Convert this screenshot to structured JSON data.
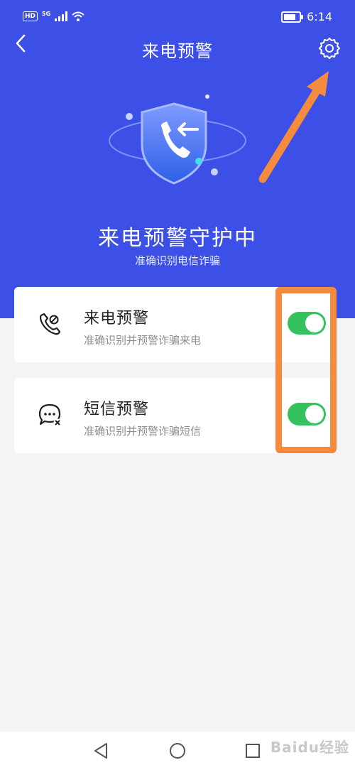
{
  "status_bar": {
    "network_badge": "HD",
    "network_type": "5G",
    "time": "6:14"
  },
  "header": {
    "title": "来电预警",
    "back_icon": "chevron-left-icon",
    "settings_icon": "gear-icon"
  },
  "hero": {
    "status_title": "来电预警守护中",
    "status_subtitle": "准确识别电信诈骗",
    "illustration_icon": "shield-phone-icon"
  },
  "features": [
    {
      "title": "来电预警",
      "description": "准确识别并预警诈骗来电",
      "icon": "phone-warning-icon",
      "enabled": true
    },
    {
      "title": "短信预警",
      "description": "准确识别并预警诈骗短信",
      "icon": "message-warning-icon",
      "enabled": true
    }
  ],
  "nav_bar": {
    "back_icon": "triangle-back-icon",
    "home_icon": "circle-home-icon",
    "recents_icon": "square-recents-icon"
  },
  "colors": {
    "hero_bg": "#3c4fe6",
    "toggle_on": "#33c25e",
    "annotation": "#f58b3c",
    "page_bg": "#f4f4f6"
  },
  "watermark": "Baidu经验"
}
